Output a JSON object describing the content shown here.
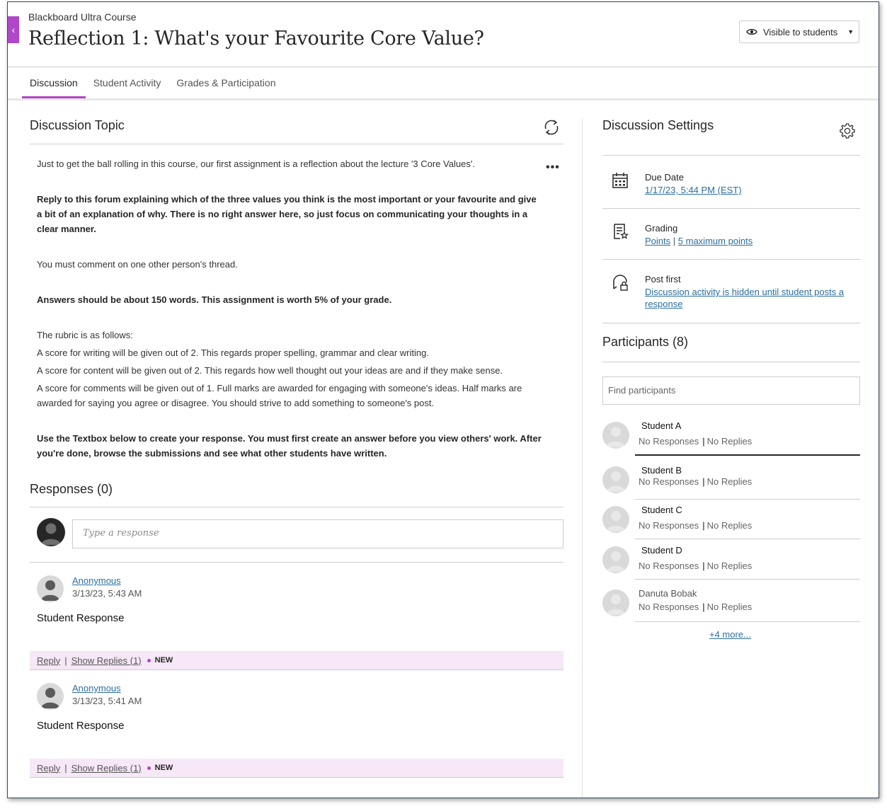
{
  "header": {
    "course_name": "Blackboard Ultra Course",
    "title": "Reflection 1: What's your Favourite Core Value?",
    "visibility_label": "Visible to students",
    "back_icon": "chevron-left-icon"
  },
  "tabs": [
    {
      "label": "Discussion",
      "active": true
    },
    {
      "label": "Student Activity",
      "active": false
    },
    {
      "label": "Grades & Participation",
      "active": false
    }
  ],
  "topic": {
    "heading": "Discussion Topic",
    "paragraphs": {
      "p1": "Just to get the ball rolling in this course, our first assignment is a reflection about the lecture '3 Core Values'.",
      "p2": "Reply to this forum explaining which of the three values you think is the most important or your favourite and give a bit of an explanation of why. There is no right answer here, so just focus on communicating your thoughts in a clear manner.",
      "p3": "You must comment on one other person's thread.",
      "p4": "Answers should be about 150 words. This assignment is worth 5% of your grade.",
      "p5": "The rubric is as follows:",
      "p6": "A score for writing will be given out of 2. This regards proper spelling, grammar and clear writing.",
      "p7": "A score for content will be given out of 2. This regards how well thought out your ideas are and if they make sense.",
      "p8": "A score for comments will be given out of 1. Full marks are awarded for engaging with someone's ideas. Half marks are awarded for saying you agree or disagree. You should strive to add something to someone's post.",
      "p9": "Use the Textbox below to create your response. You must first create an answer before you view others' work. After you're done, browse the submissions and see what other students have written."
    }
  },
  "responses": {
    "heading": "Responses (0)",
    "composer_placeholder": "Type a response",
    "posts": [
      {
        "author": "Anonymous",
        "date": "3/13/23, 5:43 AM",
        "text": "Student Response",
        "reply": "Reply",
        "show_replies": "Show Replies (1)",
        "badge": "NEW"
      },
      {
        "author": "Anonymous",
        "date": "3/13/23, 5:41 AM",
        "text": "Student Response",
        "reply": "Reply",
        "show_replies": "Show Replies (1)",
        "badge": "NEW"
      }
    ]
  },
  "settings": {
    "heading": "Discussion Settings",
    "due_date": {
      "label": "Due Date",
      "value": "1/17/23, 5:44 PM (EST)"
    },
    "grading": {
      "label": "Grading",
      "value_a": "Points",
      "sep": "|",
      "value_b": "5 maximum points"
    },
    "post_first": {
      "label": "Post first",
      "value": "Discussion activity is hidden until student posts a response"
    }
  },
  "participants": {
    "heading": "Participants (8)",
    "search_placeholder": "Find participants",
    "list": [
      {
        "name": "Student A",
        "responses": "No Responses",
        "replies": "No Replies"
      },
      {
        "name": "Student B",
        "responses": "No Responses",
        "replies": "No Replies"
      },
      {
        "name": "Student C",
        "responses": "No Responses",
        "replies": "No Replies"
      },
      {
        "name": "Student D",
        "responses": "No Responses",
        "replies": "No Replies"
      },
      {
        "name": "Danuta Bobak",
        "responses": "No Responses",
        "replies": "No Replies"
      }
    ],
    "more_link": "+4 more..."
  },
  "colors": {
    "accent": "#b046c8",
    "link": "#2c6e9e",
    "post_bar": "#f6e8f6"
  }
}
